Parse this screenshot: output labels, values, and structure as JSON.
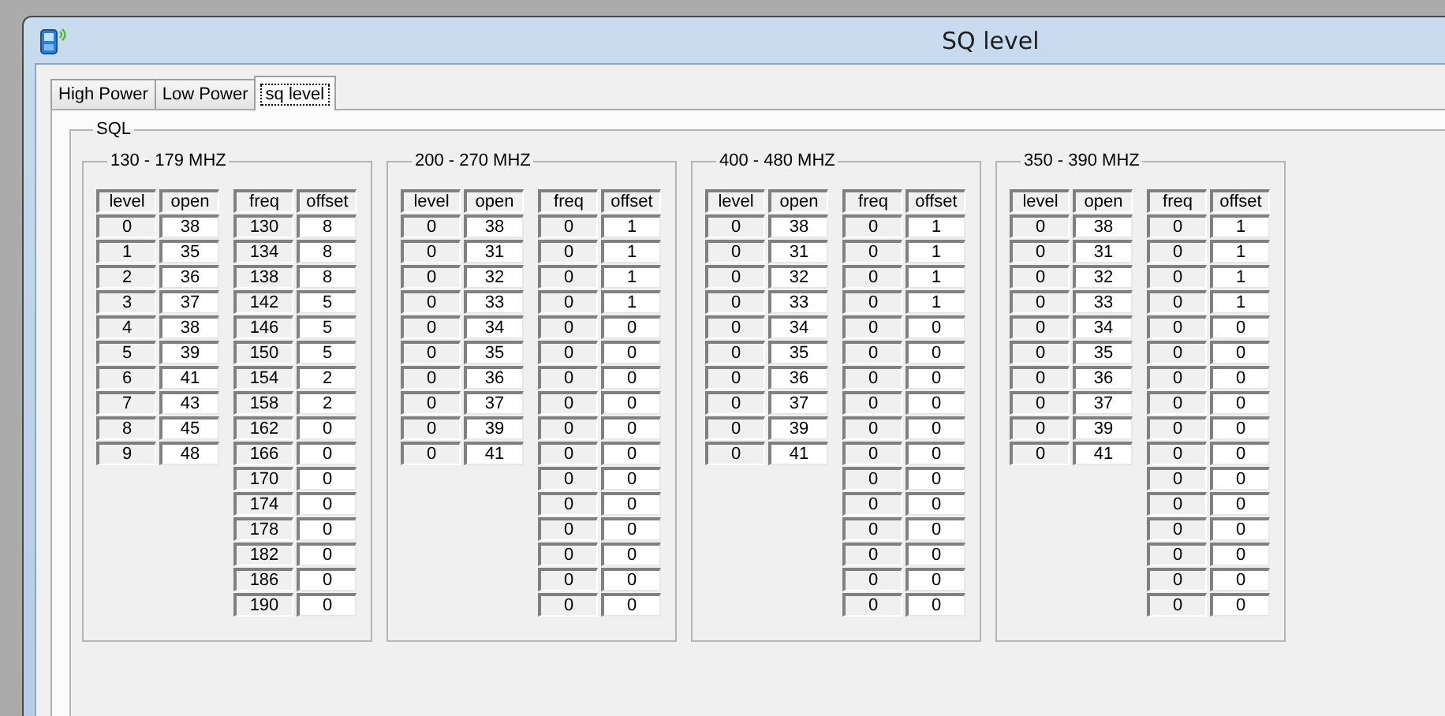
{
  "window": {
    "title": "SQ level"
  },
  "tabs": [
    {
      "label": "High Power",
      "selected": false
    },
    {
      "label": "Low Power",
      "selected": false
    },
    {
      "label": "sq level",
      "selected": true
    }
  ],
  "sql_group": {
    "title": "SQL",
    "bands": [
      {
        "title": "130 - 179 MHZ",
        "level_table": {
          "columns": [
            "level",
            "open"
          ],
          "rows": [
            [
              "0",
              "38"
            ],
            [
              "1",
              "35"
            ],
            [
              "2",
              "36"
            ],
            [
              "3",
              "37"
            ],
            [
              "4",
              "38"
            ],
            [
              "5",
              "39"
            ],
            [
              "6",
              "41"
            ],
            [
              "7",
              "43"
            ],
            [
              "8",
              "45"
            ],
            [
              "9",
              "48"
            ]
          ]
        },
        "freq_table": {
          "columns": [
            "freq",
            "offset"
          ],
          "rows": [
            [
              "130",
              "8"
            ],
            [
              "134",
              "8"
            ],
            [
              "138",
              "8"
            ],
            [
              "142",
              "5"
            ],
            [
              "146",
              "5"
            ],
            [
              "150",
              "5"
            ],
            [
              "154",
              "2"
            ],
            [
              "158",
              "2"
            ],
            [
              "162",
              "0"
            ],
            [
              "166",
              "0"
            ],
            [
              "170",
              "0"
            ],
            [
              "174",
              "0"
            ],
            [
              "178",
              "0"
            ],
            [
              "182",
              "0"
            ],
            [
              "186",
              "0"
            ],
            [
              "190",
              "0"
            ]
          ]
        }
      },
      {
        "title": "200 - 270 MHZ",
        "level_table": {
          "columns": [
            "level",
            "open"
          ],
          "rows": [
            [
              "0",
              "38"
            ],
            [
              "0",
              "31"
            ],
            [
              "0",
              "32"
            ],
            [
              "0",
              "33"
            ],
            [
              "0",
              "34"
            ],
            [
              "0",
              "35"
            ],
            [
              "0",
              "36"
            ],
            [
              "0",
              "37"
            ],
            [
              "0",
              "39"
            ],
            [
              "0",
              "41"
            ]
          ]
        },
        "freq_table": {
          "columns": [
            "freq",
            "offset"
          ],
          "rows": [
            [
              "0",
              "1"
            ],
            [
              "0",
              "1"
            ],
            [
              "0",
              "1"
            ],
            [
              "0",
              "1"
            ],
            [
              "0",
              "0"
            ],
            [
              "0",
              "0"
            ],
            [
              "0",
              "0"
            ],
            [
              "0",
              "0"
            ],
            [
              "0",
              "0"
            ],
            [
              "0",
              "0"
            ],
            [
              "0",
              "0"
            ],
            [
              "0",
              "0"
            ],
            [
              "0",
              "0"
            ],
            [
              "0",
              "0"
            ],
            [
              "0",
              "0"
            ],
            [
              "0",
              "0"
            ]
          ]
        }
      },
      {
        "title": "400 - 480 MHZ",
        "level_table": {
          "columns": [
            "level",
            "open"
          ],
          "rows": [
            [
              "0",
              "38"
            ],
            [
              "0",
              "31"
            ],
            [
              "0",
              "32"
            ],
            [
              "0",
              "33"
            ],
            [
              "0",
              "34"
            ],
            [
              "0",
              "35"
            ],
            [
              "0",
              "36"
            ],
            [
              "0",
              "37"
            ],
            [
              "0",
              "39"
            ],
            [
              "0",
              "41"
            ]
          ]
        },
        "freq_table": {
          "columns": [
            "freq",
            "offset"
          ],
          "rows": [
            [
              "0",
              "1"
            ],
            [
              "0",
              "1"
            ],
            [
              "0",
              "1"
            ],
            [
              "0",
              "1"
            ],
            [
              "0",
              "0"
            ],
            [
              "0",
              "0"
            ],
            [
              "0",
              "0"
            ],
            [
              "0",
              "0"
            ],
            [
              "0",
              "0"
            ],
            [
              "0",
              "0"
            ],
            [
              "0",
              "0"
            ],
            [
              "0",
              "0"
            ],
            [
              "0",
              "0"
            ],
            [
              "0",
              "0"
            ],
            [
              "0",
              "0"
            ],
            [
              "0",
              "0"
            ]
          ]
        }
      },
      {
        "title": "350 - 390 MHZ",
        "level_table": {
          "columns": [
            "level",
            "open"
          ],
          "rows": [
            [
              "0",
              "38"
            ],
            [
              "0",
              "31"
            ],
            [
              "0",
              "32"
            ],
            [
              "0",
              "33"
            ],
            [
              "0",
              "34"
            ],
            [
              "0",
              "35"
            ],
            [
              "0",
              "36"
            ],
            [
              "0",
              "37"
            ],
            [
              "0",
              "39"
            ],
            [
              "0",
              "41"
            ]
          ]
        },
        "freq_table": {
          "columns": [
            "freq",
            "offset"
          ],
          "rows": [
            [
              "0",
              "1"
            ],
            [
              "0",
              "1"
            ],
            [
              "0",
              "1"
            ],
            [
              "0",
              "1"
            ],
            [
              "0",
              "0"
            ],
            [
              "0",
              "0"
            ],
            [
              "0",
              "0"
            ],
            [
              "0",
              "0"
            ],
            [
              "0",
              "0"
            ],
            [
              "0",
              "0"
            ],
            [
              "0",
              "0"
            ],
            [
              "0",
              "0"
            ],
            [
              "0",
              "0"
            ],
            [
              "0",
              "0"
            ],
            [
              "0",
              "0"
            ],
            [
              "0",
              "0"
            ]
          ]
        }
      }
    ]
  }
}
